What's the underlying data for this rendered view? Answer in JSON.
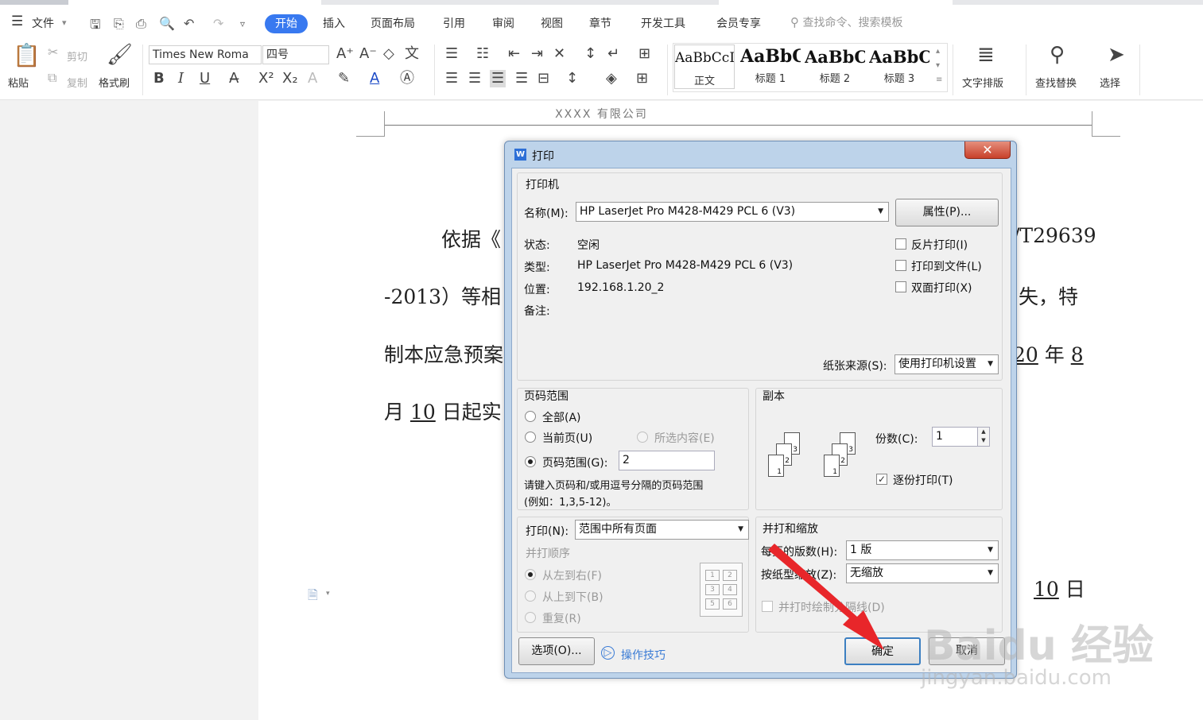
{
  "menu": {
    "file": "文件",
    "tabs": [
      "开始",
      "插入",
      "页面布局",
      "引用",
      "审阅",
      "视图",
      "章节",
      "开发工具",
      "会员专享"
    ],
    "search_placeholder": "查找命令、搜索模板"
  },
  "ribbon": {
    "paste": "粘贴",
    "cut": "剪切",
    "copy": "复制",
    "format_painter": "格式刷",
    "font_name": "Times New Roma",
    "font_size": "四号",
    "styles": [
      {
        "sample": "AaBbCcI",
        "label": "正文"
      },
      {
        "sample": "AaBbC",
        "label": "标题 1"
      },
      {
        "sample": "AaBbC",
        "label": "标题 2"
      },
      {
        "sample": "AaBbC",
        "label": "标题 3"
      }
    ],
    "text_layout": "文字排版",
    "find_replace": "查找替换",
    "select": "选择"
  },
  "document": {
    "header": "XXXX 有限公司",
    "line1_start": "依据《",
    "line1_end": "/T29639",
    "line2_start": "-2013）等相",
    "line2_end": "失，特",
    "line3_start": "制本应急预案",
    "line3_year": "20",
    "line3_year_suffix": "年",
    "line3_month": "8",
    "line4_prefix": "月",
    "line4_day": "10",
    "line4_suffix": "日起实",
    "line5_day": "10",
    "line5_suffix": "日"
  },
  "dialog": {
    "title": "打印",
    "close": "✕",
    "printer_group": "打印机",
    "name_label": "名称(M):",
    "printer_name": "HP LaserJet Pro M428-M429 PCL 6 (V3)",
    "properties": "属性(P)...",
    "status_label": "状态:",
    "status_value": "空闲",
    "type_label": "类型:",
    "type_value": "HP LaserJet Pro M428-M429 PCL 6 (V3)",
    "location_label": "位置:",
    "location_value": "192.168.1.20_2",
    "comment_label": "备注:",
    "reverse_print": "反片打印(I)",
    "print_to_file": "打印到文件(L)",
    "duplex": "双面打印(X)",
    "paper_source_label": "纸张来源(S):",
    "paper_source_value": "使用打印机设置",
    "range_group": "页码范围",
    "all": "全部(A)",
    "current_page": "当前页(U)",
    "selection": "所选内容(E)",
    "page_range": "页码范围(G):",
    "page_range_value": "2",
    "range_hint_1": "请键入页码和/或用逗号分隔的页码范围",
    "range_hint_2": "(例如：1,3,5-12)。",
    "copies_group": "副本",
    "copies_label": "份数(C):",
    "copies_value": "1",
    "collate": "逐份打印(T)",
    "print_label": "打印(N):",
    "print_value": "范围中所有页面",
    "order_group": "并打顺序",
    "left_to_right": "从左到右(F)",
    "top_to_bottom": "从上到下(B)",
    "repeat": "重复(R)",
    "scale_group": "并打和缩放",
    "pages_per_sheet_label": "每页的版数(H):",
    "pages_per_sheet_value": "1 版",
    "scale_label": "按纸型缩放(Z):",
    "scale_value": "无缩放",
    "draw_borders": "并打时绘制分隔线(D)",
    "options": "选项(O)...",
    "tips": "操作技巧",
    "ok": "确定",
    "cancel": "取消"
  },
  "watermark": {
    "main": "Baidu 经验",
    "sub": "jingyan.baidu.com"
  }
}
